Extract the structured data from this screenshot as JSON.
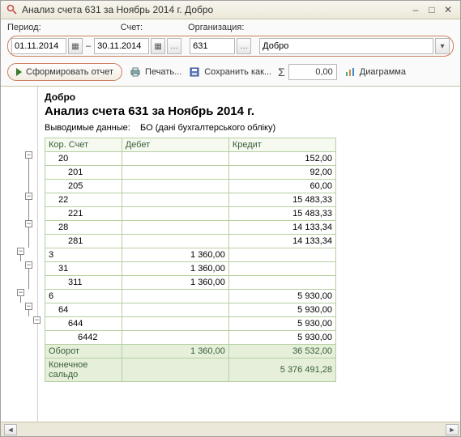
{
  "window": {
    "title": "Анализ счета 631 за Ноябрь 2014 г. Добро"
  },
  "filters": {
    "period_label": "Период:",
    "account_label": "Счет:",
    "org_label": "Организация:",
    "date_from": "01.11.2014",
    "date_to": "30.11.2014",
    "account": "631",
    "organization": "Добро"
  },
  "toolbar": {
    "form_report": "Сформировать отчет",
    "print": "Печать...",
    "save_as": "Сохранить как...",
    "sum_symbol": "Σ",
    "sum_value": "0,00",
    "chart": "Диаграмма"
  },
  "chart_data": {
    "type": "table",
    "title": "Анализ счета 631 за Ноябрь 2014 г.",
    "organization": "Добро",
    "subtitle_label": "Выводимые данные:",
    "subtitle_value": "БО (дані бухгалтерського обліку)",
    "columns": [
      "Кор. Счет",
      "Дебет",
      "Кредит"
    ],
    "rows": [
      {
        "acct": "20",
        "indent": 1,
        "debit": "",
        "credit": "152,00"
      },
      {
        "acct": "201",
        "indent": 2,
        "debit": "",
        "credit": "92,00"
      },
      {
        "acct": "205",
        "indent": 2,
        "debit": "",
        "credit": "60,00"
      },
      {
        "acct": "22",
        "indent": 1,
        "debit": "",
        "credit": "15 483,33"
      },
      {
        "acct": "221",
        "indent": 2,
        "debit": "",
        "credit": "15 483,33"
      },
      {
        "acct": "28",
        "indent": 1,
        "debit": "",
        "credit": "14 133,34"
      },
      {
        "acct": "281",
        "indent": 2,
        "debit": "",
        "credit": "14 133,34"
      },
      {
        "acct": "3",
        "indent": 0,
        "debit": "1 360,00",
        "credit": ""
      },
      {
        "acct": "31",
        "indent": 1,
        "debit": "1 360,00",
        "credit": ""
      },
      {
        "acct": "311",
        "indent": 2,
        "debit": "1 360,00",
        "credit": ""
      },
      {
        "acct": "6",
        "indent": 0,
        "debit": "",
        "credit": "5 930,00"
      },
      {
        "acct": "64",
        "indent": 1,
        "debit": "",
        "credit": "5 930,00"
      },
      {
        "acct": "644",
        "indent": 2,
        "debit": "",
        "credit": "5 930,00"
      },
      {
        "acct": "6442",
        "indent": 3,
        "debit": "",
        "credit": "5 930,00"
      }
    ],
    "totals": [
      {
        "label": "Оборот",
        "debit": "1 360,00",
        "credit": "36 532,00"
      },
      {
        "label": "Конечное сальдо",
        "debit": "",
        "credit": "5 376 491,28"
      }
    ]
  }
}
